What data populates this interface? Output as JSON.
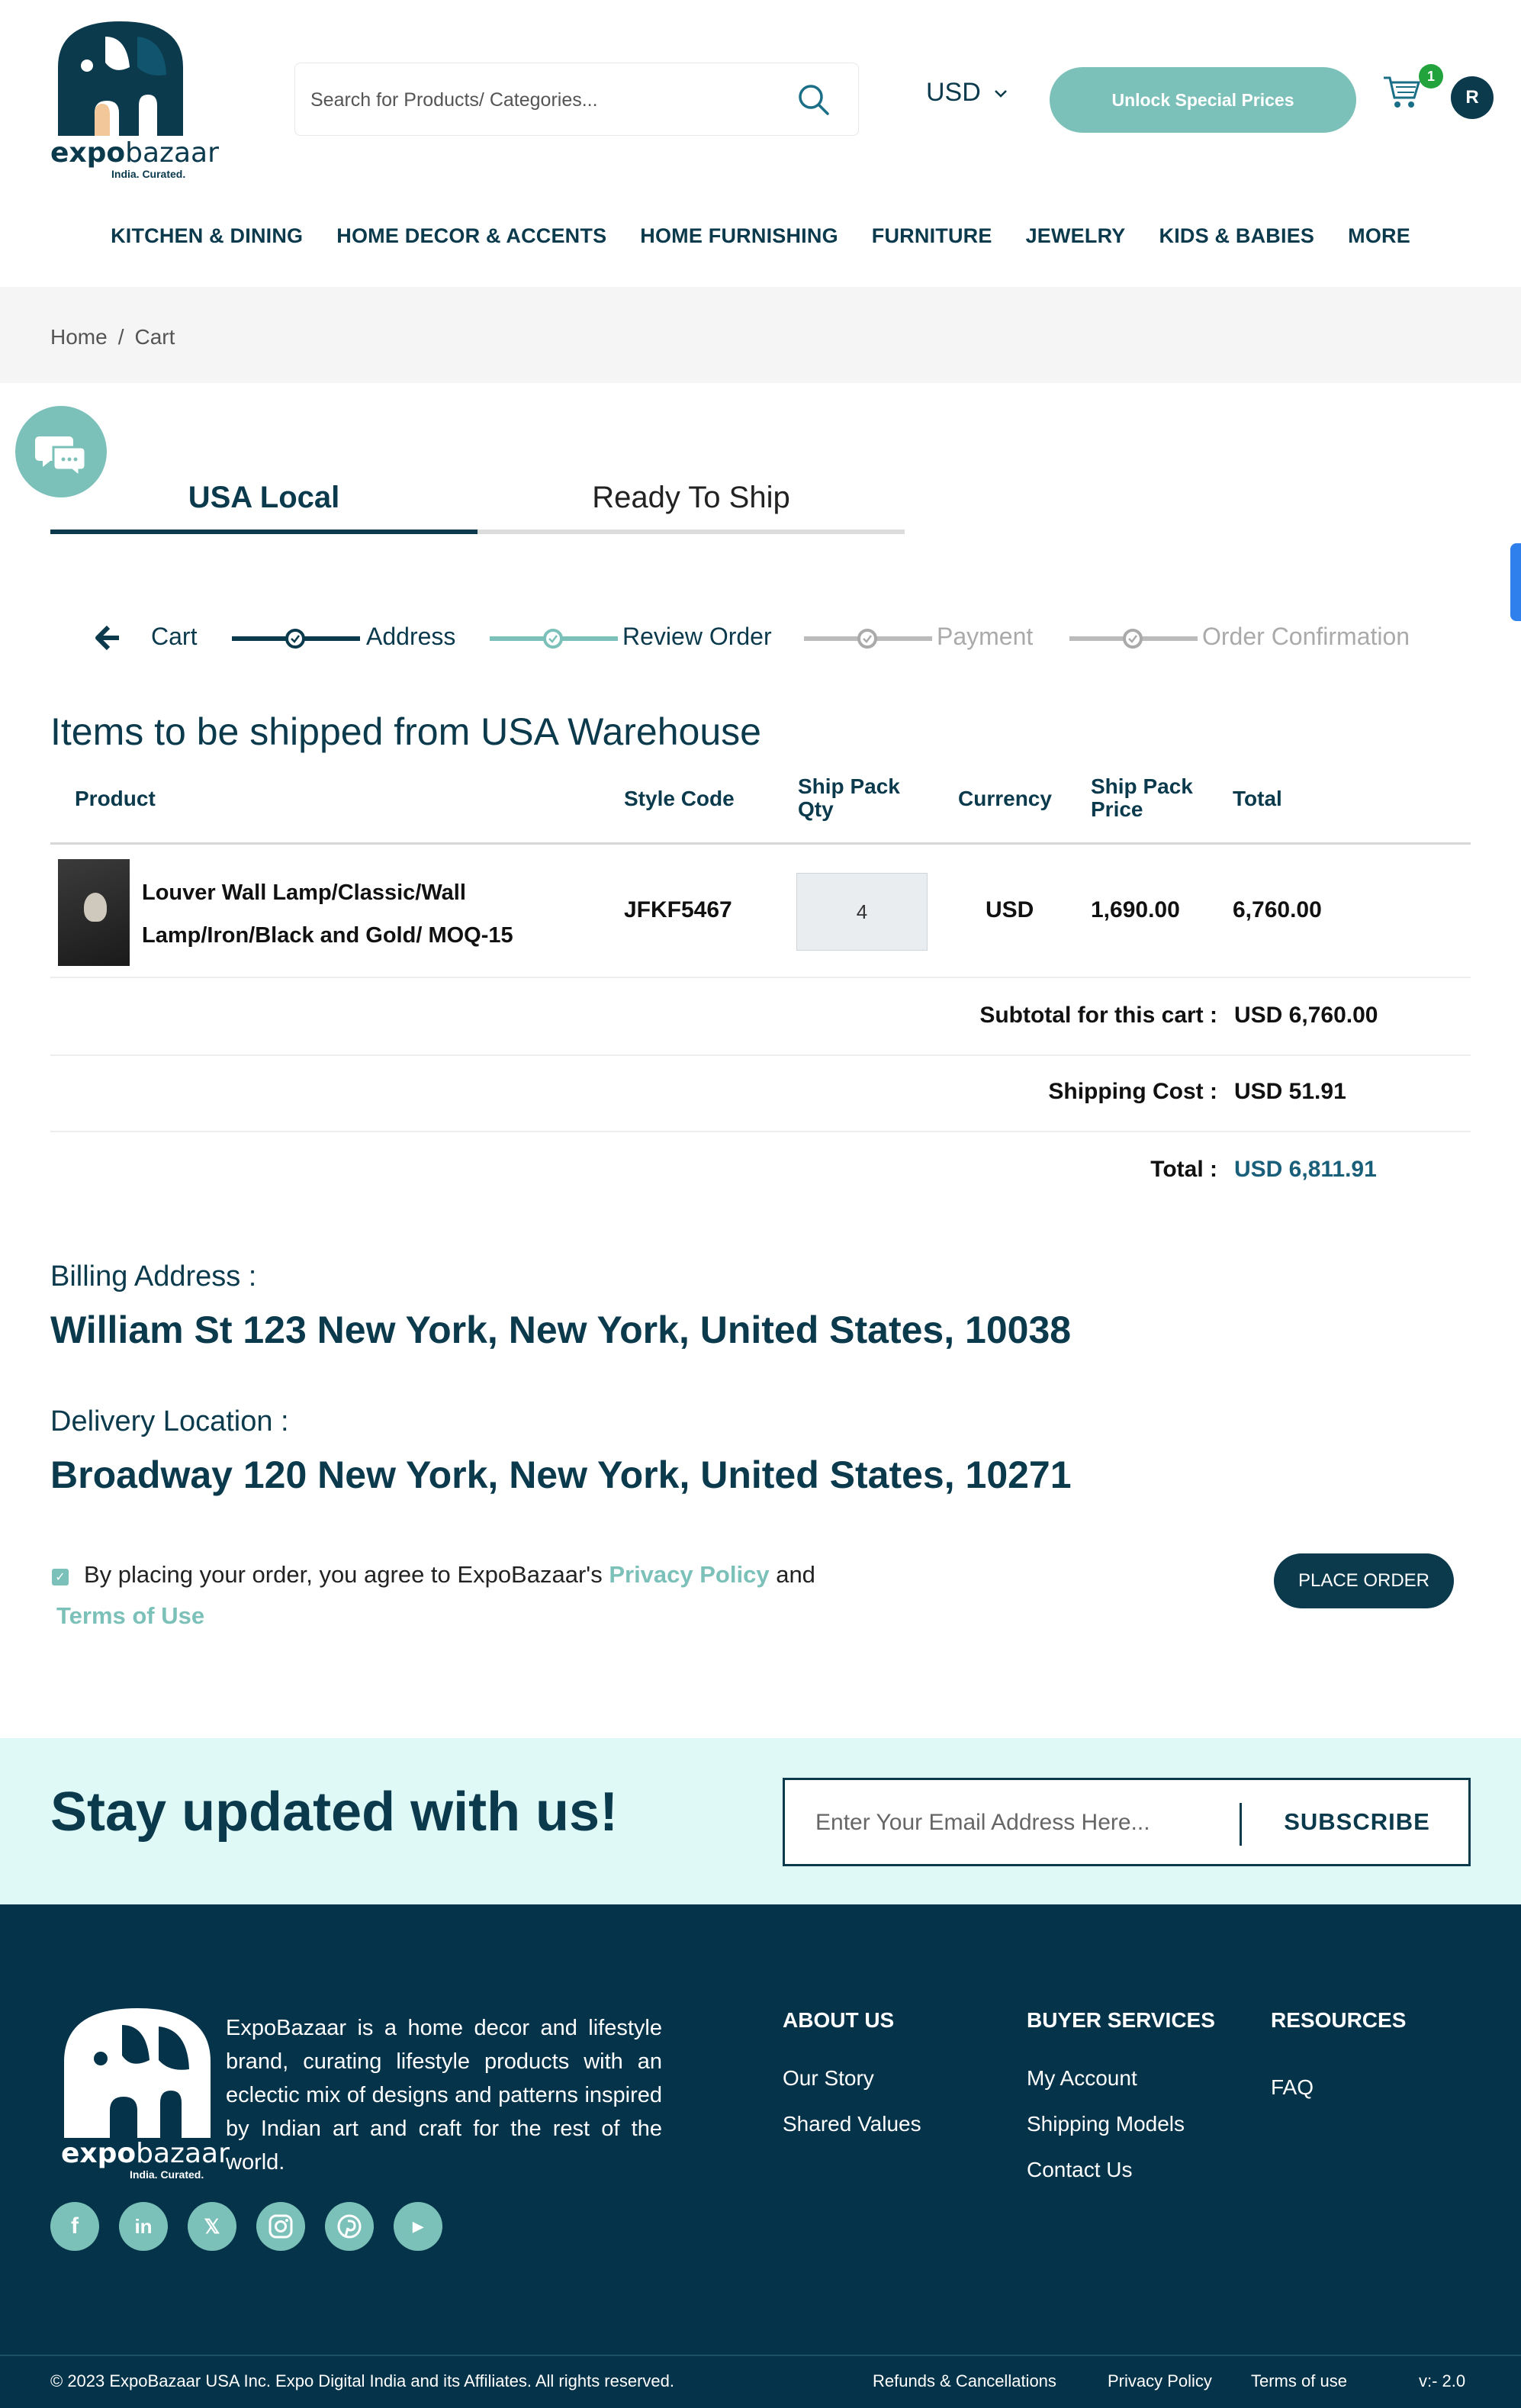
{
  "header": {
    "logo_text_bold": "expo",
    "logo_text": "bazaar",
    "logo_tagline": "India. Curated.",
    "search_placeholder": "Search for Products/ Categories...",
    "currency": "USD",
    "unlock_label": "Unlock Special Prices",
    "cart_count": "1",
    "avatar_initial": "R"
  },
  "nav": {
    "items": [
      "KITCHEN & DINING",
      "HOME DECOR & ACCENTS",
      "HOME FURNISHING",
      "FURNITURE",
      "JEWELRY",
      "KIDS & BABIES",
      "MORE"
    ]
  },
  "breadcrumb": {
    "home": "Home",
    "separator": "/",
    "current": "Cart"
  },
  "tabs": {
    "usa_local": "USA Local",
    "ready_to_ship": "Ready To Ship"
  },
  "stepper": {
    "cart": "Cart",
    "address": "Address",
    "review": "Review Order",
    "payment": "Payment",
    "confirmation": "Order Confirmation"
  },
  "section_title": "Items to be shipped from USA Warehouse",
  "table": {
    "headers": {
      "product": "Product",
      "style_code": "Style Code",
      "ship_pack_qty": "Ship Pack Qty",
      "currency": "Currency",
      "ship_pack_price": "Ship Pack Price",
      "total": "Total"
    },
    "rows": [
      {
        "name": "Louver Wall Lamp/Classic/Wall Lamp/Iron/Black and Gold/ MOQ-15",
        "style_code": "JFKF5467",
        "qty": "4",
        "currency": "USD",
        "price": "1,690.00",
        "total": "6,760.00"
      }
    ]
  },
  "summary": {
    "subtotal_label": "Subtotal for this cart :",
    "subtotal_value": "USD 6,760.00",
    "shipping_label": "Shipping Cost :",
    "shipping_value": "USD 51.91",
    "total_label": "Total :",
    "total_value": "USD 6,811.91"
  },
  "billing": {
    "label": "Billing Address :",
    "value": "William St 123 New York, New York, United States, 10038"
  },
  "delivery": {
    "label": "Delivery Location :",
    "value": "Broadway 120 New York, New York, United States, 10271"
  },
  "agreement": {
    "text": "By placing your order, you agree to ExpoBazaar's",
    "privacy": "Privacy Policy",
    "and": "and",
    "terms": "Terms of Use",
    "checked": true
  },
  "place_order_label": "PLACE ORDER",
  "newsletter": {
    "title": "Stay updated with us!",
    "placeholder": "Enter Your Email Address Here...",
    "button": "SUBSCRIBE"
  },
  "footer": {
    "about_text": "ExpoBazaar is a home decor and lifestyle brand, curating lifestyle products with an eclectic mix of designs and patterns inspired by Indian art and craft for the rest of the world.",
    "social": [
      "facebook-icon",
      "linkedin-icon",
      "x-icon",
      "instagram-icon",
      "pinterest-icon",
      "youtube-icon"
    ],
    "columns": {
      "about": {
        "title": "ABOUT US",
        "links": [
          "Our Story",
          "Shared Values"
        ]
      },
      "buyer": {
        "title": "BUYER SERVICES",
        "links": [
          "My Account",
          "Shipping Models",
          "Contact Us"
        ]
      },
      "resources": {
        "title": "RESOURCES",
        "links": [
          "FAQ"
        ]
      }
    },
    "copyright": "© 2023 ExpoBazaar USA Inc. Expo Digital India and its Affiliates. All rights reserved.",
    "bottom_links": [
      "Refunds & Cancellations",
      "Privacy Policy",
      "Terms of use"
    ],
    "version": "v:- 2.0"
  },
  "colors": {
    "brand_dark": "#0b3a4d",
    "accent_teal": "#7cc1b9",
    "footer_bg": "#053349",
    "newsletter_bg": "#dff9f7"
  }
}
